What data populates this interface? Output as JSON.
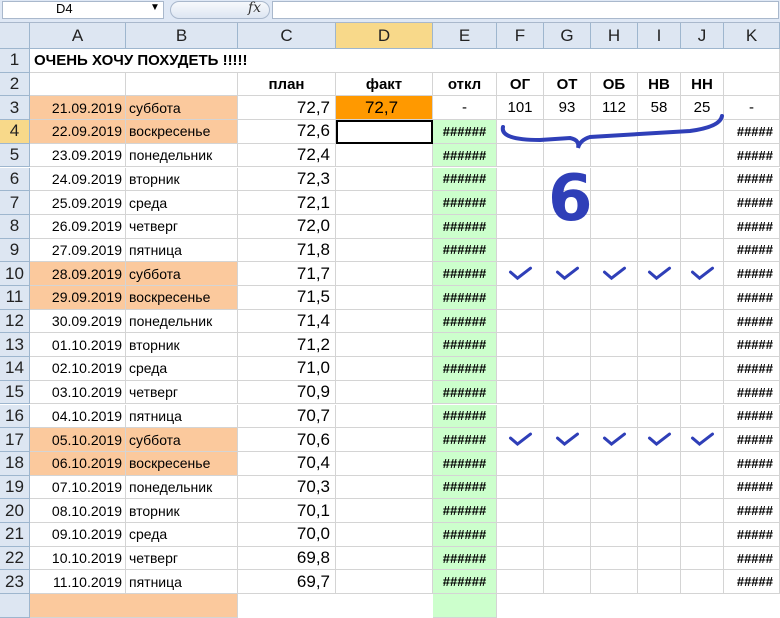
{
  "formula_bar": {
    "name_box": "D4",
    "fx_symbol": "fx",
    "formula": ""
  },
  "columns": [
    "A",
    "B",
    "C",
    "D",
    "E",
    "F",
    "G",
    "H",
    "I",
    "J",
    "K"
  ],
  "selected_column": "D",
  "selected_row": "4",
  "title": "ОЧЕНЬ ХОЧУ ПОХУДЕТЬ !!!!!",
  "headers": {
    "plan": "план",
    "fact": "факт",
    "dev": "откл",
    "f": "ОГ",
    "g": "ОТ",
    "h": "ОБ",
    "i": "НВ",
    "j": "НН"
  },
  "row3": {
    "date": "21.09.2019",
    "day": "суббота",
    "plan": "72,7",
    "fact": "72,7",
    "dev": "-",
    "f": "101",
    "g": "93",
    "h": "112",
    "i": "58",
    "j": "25",
    "k": "-"
  },
  "overflow_text": "######",
  "overflow_text_k": "#####",
  "rows": [
    {
      "n": "4",
      "date": "22.09.2019",
      "day": "воскресенье",
      "plan": "72,6",
      "weekend": true
    },
    {
      "n": "5",
      "date": "23.09.2019",
      "day": "понедельник",
      "plan": "72,4",
      "weekend": false
    },
    {
      "n": "6",
      "date": "24.09.2019",
      "day": "вторник",
      "plan": "72,3",
      "weekend": false
    },
    {
      "n": "7",
      "date": "25.09.2019",
      "day": "среда",
      "plan": "72,1",
      "weekend": false
    },
    {
      "n": "8",
      "date": "26.09.2019",
      "day": "четверг",
      "plan": "72,0",
      "weekend": false
    },
    {
      "n": "9",
      "date": "27.09.2019",
      "day": "пятница",
      "plan": "71,8",
      "weekend": false
    },
    {
      "n": "10",
      "date": "28.09.2019",
      "day": "суббота",
      "plan": "71,7",
      "weekend": true
    },
    {
      "n": "11",
      "date": "29.09.2019",
      "day": "воскресенье",
      "plan": "71,5",
      "weekend": true
    },
    {
      "n": "12",
      "date": "30.09.2019",
      "day": "понедельник",
      "plan": "71,4",
      "weekend": false
    },
    {
      "n": "13",
      "date": "01.10.2019",
      "day": "вторник",
      "plan": "71,2",
      "weekend": false
    },
    {
      "n": "14",
      "date": "02.10.2019",
      "day": "среда",
      "plan": "71,0",
      "weekend": false
    },
    {
      "n": "15",
      "date": "03.10.2019",
      "day": "четверг",
      "plan": "70,9",
      "weekend": false
    },
    {
      "n": "16",
      "date": "04.10.2019",
      "day": "пятница",
      "plan": "70,7",
      "weekend": false
    },
    {
      "n": "17",
      "date": "05.10.2019",
      "day": "суббота",
      "plan": "70,6",
      "weekend": true
    },
    {
      "n": "18",
      "date": "06.10.2019",
      "day": "воскресенье",
      "plan": "70,4",
      "weekend": true
    },
    {
      "n": "19",
      "date": "07.10.2019",
      "day": "понедельник",
      "plan": "70,3",
      "weekend": false
    },
    {
      "n": "20",
      "date": "08.10.2019",
      "day": "вторник",
      "plan": "70,1",
      "weekend": false
    },
    {
      "n": "21",
      "date": "09.10.2019",
      "day": "среда",
      "plan": "70,0",
      "weekend": false
    },
    {
      "n": "22",
      "date": "10.10.2019",
      "day": "четверг",
      "plan": "69,8",
      "weekend": false
    },
    {
      "n": "23",
      "date": "11.10.2019",
      "day": "пятница",
      "plan": "69,7",
      "weekend": false
    }
  ],
  "annotations": {
    "handwritten_digit": "6",
    "check_rows": [
      "10",
      "17"
    ],
    "ink_color": "#2f3fb8"
  },
  "colors": {
    "weekend": "#fbc99d",
    "fact": "#ff9900",
    "deviation": "#ccffcc",
    "selection": "#000000"
  }
}
